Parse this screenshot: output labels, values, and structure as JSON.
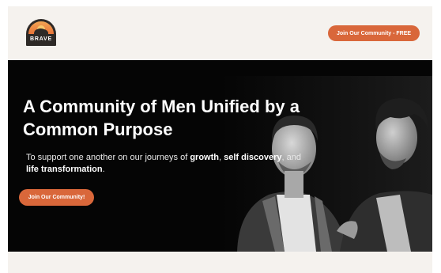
{
  "header": {
    "logo_text": "BRAVE",
    "cta_label": "Join Our Community - FREE"
  },
  "hero": {
    "title": "A Community of Men Unified by a Common Purpose",
    "subtitle": {
      "part1": "To support one another on our journeys of ",
      "bold1": "growth",
      "part2": ", ",
      "bold2": "self discovery",
      "part3": ", and ",
      "bold3": "life transformation",
      "part4": "."
    },
    "cta_label": "Join Our Community!"
  },
  "colors": {
    "accent": "#d9673a",
    "hero_background": "#050505",
    "page_background": "#f5f2ee"
  },
  "icons": {
    "logo": "bison-sunset-logo"
  }
}
